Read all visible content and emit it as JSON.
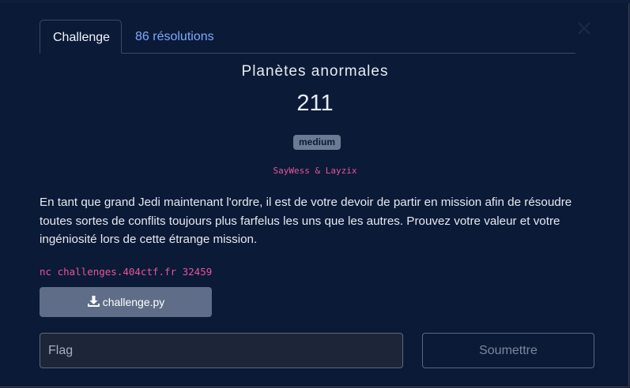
{
  "tabs": [
    {
      "label": "Challenge",
      "active": true
    },
    {
      "label": "86 résolutions",
      "active": false
    }
  ],
  "challenge": {
    "title": "Planètes anormales",
    "points": "211",
    "difficulty": "medium",
    "authors": "SayWess & Layzix",
    "description": "En tant que grand Jedi maintenant l'ordre, il est de votre devoir de partir en mission afin de résoudre toutes sortes de conflits toujours plus farfelus les uns que les autres. Prouvez votre valeur et votre ingéniosité lors de cette étrange mission.",
    "connection": "nc challenges.404ctf.fr 32459",
    "file": "challenge.py"
  },
  "form": {
    "flag_placeholder": "Flag",
    "flag_value": "",
    "submit_label": "Soumettre"
  },
  "icons": {
    "close": "close-icon",
    "download": "download-icon"
  },
  "colors": {
    "background": "#0b1a37",
    "accent_link": "#7ea9ff",
    "pink_mono": "#e8559a",
    "badge": "#6c7a93",
    "button": "#5f6d88"
  }
}
